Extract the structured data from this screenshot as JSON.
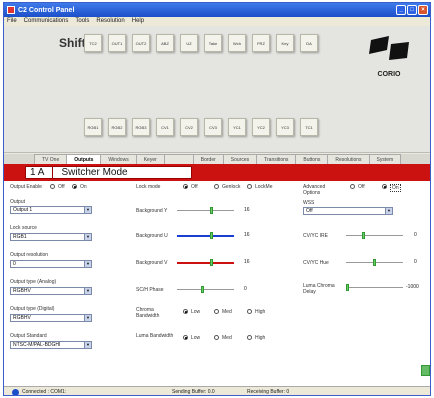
{
  "window": {
    "title": "C2 Control Panel"
  },
  "menu": [
    "File",
    "Communications",
    "Tools",
    "Resolution",
    "Help"
  ],
  "shift": {
    "label": "Shift",
    "row1": [
      "TC2",
      "OUT1",
      "OUT2",
      "ABZ",
      "UZ",
      "Take",
      "Wch",
      "FRZ",
      "Key",
      "DA"
    ],
    "row2": [
      "RGB1",
      "RGB2",
      "RGB3",
      "CV1",
      "CV2",
      "CV3",
      "YC1",
      "YC2",
      "YC3",
      "TC1"
    ]
  },
  "brand": {
    "logo": "CORIO"
  },
  "tabs": [
    "TV One",
    "Outputs",
    "Windows",
    "Keyer",
    "",
    "Border",
    "Sources",
    "Transitions",
    "Buttons",
    "Resolutions",
    "System"
  ],
  "active_tab": "Outputs",
  "header": {
    "unit": "1 A",
    "mode": "Switcher Mode"
  },
  "outputs": {
    "output_enable": {
      "label": "Output Enable",
      "off": "Off",
      "on": "On",
      "selected": "On"
    },
    "output": {
      "label": "Output",
      "value": "Output 1"
    },
    "lock_source": {
      "label": "Lock source",
      "value": "RGB1"
    },
    "output_resolution": {
      "label": "Output resolution",
      "value": "0"
    },
    "output_type_analog": {
      "label": "Output type (Analog)",
      "value": "RGBHV"
    },
    "output_type_digital": {
      "label": "Output type (Digital)",
      "value": "RGBHV"
    },
    "output_standard": {
      "label": "Output Standard",
      "value": "NTSC-M/PAL-BDGHI"
    }
  },
  "middle": {
    "lock_mode": {
      "label": "Lock mode",
      "off": "Off",
      "genlock": "Genlock",
      "lockme": "LockMe",
      "selected": "Off"
    },
    "background_y": {
      "label": "Background Y",
      "value": "16",
      "color": "#999999",
      "level": 0.6
    },
    "background_u": {
      "label": "Background U",
      "value": "16",
      "color": "#1a3fd0",
      "level": 0.6
    },
    "background_v": {
      "label": "Background V",
      "value": "16",
      "color": "#cc1111",
      "level": 0.6
    },
    "sch_phase": {
      "label": "SC/H Phase",
      "value": "0",
      "level": 0.45
    },
    "chroma_bandwidth": {
      "label": "Chroma Bandwidth",
      "low": "Low",
      "med": "Med",
      "high": "High",
      "selected": "Low"
    },
    "luma_bandwidth": {
      "label": "Luma Bandwidth",
      "low": "Low",
      "med": "Med",
      "high": "High",
      "selected": "Low"
    }
  },
  "right": {
    "advanced_options": {
      "label": "Advanced Options",
      "off": "Off",
      "on": "On",
      "selected": "On"
    },
    "wss": {
      "label": "WSS",
      "value": "Off"
    },
    "cvyc_ire": {
      "label": "CV/YC IRE",
      "value": "0",
      "level": 0.3
    },
    "cvyc_hue": {
      "label": "CV/YC Hue",
      "value": "0",
      "level": 0.5
    },
    "luma_chroma_delay": {
      "label": "Luma Chroma Delay",
      "value": "-1000",
      "level": 0.0
    }
  },
  "status": {
    "connection": "Connected : COM1:",
    "sending": "Sending Buffer: 0.0",
    "receiving": "Receiving Buffer: 0"
  }
}
